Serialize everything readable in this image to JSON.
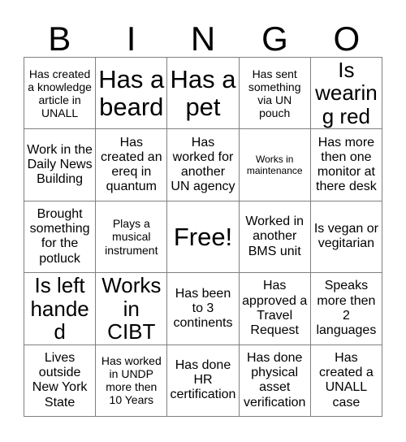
{
  "card": {
    "title": "BINGO",
    "header_letters": [
      "B",
      "I",
      "N",
      "G",
      "O"
    ],
    "rows": [
      [
        {
          "text": "Has created a knowledge article in UNALL",
          "size": "fs-sm"
        },
        {
          "text": "Has a beard",
          "size": "fs-xxl"
        },
        {
          "text": "Has a pet",
          "size": "fs-xxl"
        },
        {
          "text": "Has sent something via UN pouch",
          "size": "fs-sm"
        },
        {
          "text": "Is wearing red",
          "size": "fs-xl"
        }
      ],
      [
        {
          "text": "Work in the Daily News Building",
          "size": "fs-md"
        },
        {
          "text": "Has created an ereq in quantum",
          "size": "fs-md"
        },
        {
          "text": "Has worked for another UN agency",
          "size": "fs-md"
        },
        {
          "text": "Works in maintenance",
          "size": "fs-xs"
        },
        {
          "text": "Has more then one monitor at there desk",
          "size": "fs-md"
        }
      ],
      [
        {
          "text": "Brought something for the potluck",
          "size": "fs-md"
        },
        {
          "text": "Plays a musical instrument",
          "size": "fs-sm"
        },
        {
          "text": "Free!",
          "size": "fs-xxl"
        },
        {
          "text": "Worked in another BMS unit",
          "size": "fs-md"
        },
        {
          "text": "Is vegan or vegitarian",
          "size": "fs-md"
        }
      ],
      [
        {
          "text": "Is left handed",
          "size": "fs-xl"
        },
        {
          "text": "Works in CIBT",
          "size": "fs-xl"
        },
        {
          "text": "Has been to 3 continents",
          "size": "fs-md"
        },
        {
          "text": "Has approved a Travel Request",
          "size": "fs-md"
        },
        {
          "text": "Speaks more then 2 languages",
          "size": "fs-md"
        }
      ],
      [
        {
          "text": "Lives outside New York State",
          "size": "fs-md"
        },
        {
          "text": "Has worked in UNDP more then 10 Years",
          "size": "fs-sm"
        },
        {
          "text": "Has done HR certification",
          "size": "fs-md"
        },
        {
          "text": "Has done physical asset verification",
          "size": "fs-md"
        },
        {
          "text": "Has created a UNALL case",
          "size": "fs-md"
        }
      ]
    ],
    "free_space": {
      "row": 2,
      "column": 2,
      "label": "Free!"
    },
    "colors": {
      "background": "#ffffff",
      "text": "#000000",
      "grid_line": "#808080"
    }
  }
}
